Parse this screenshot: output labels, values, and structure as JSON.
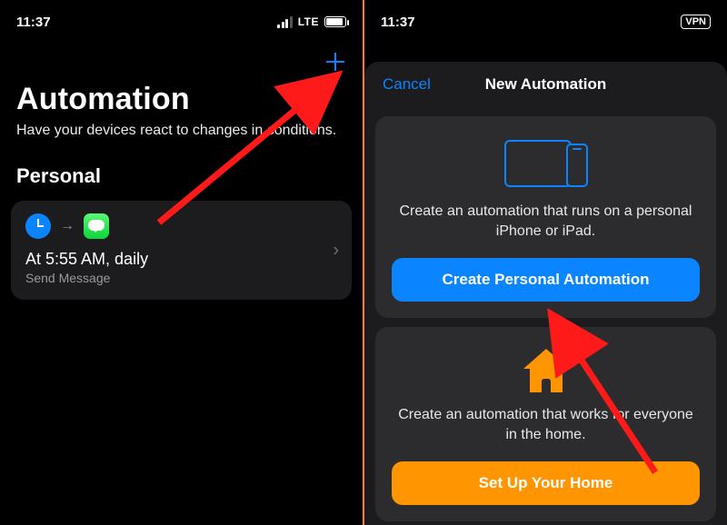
{
  "left": {
    "status": {
      "time": "11:37",
      "network": "LTE"
    },
    "title": "Automation",
    "subtitle": "Have your devices react to changes in conditions.",
    "personal_label": "Personal",
    "automation": {
      "title": "At 5:55 AM, daily",
      "subtitle": "Send Message"
    }
  },
  "right": {
    "status": {
      "time": "11:37",
      "vpn": "VPN"
    },
    "cancel": "Cancel",
    "sheet_title": "New Automation",
    "personal": {
      "desc": "Create an automation that runs on a personal iPhone or iPad.",
      "button": "Create Personal Automation"
    },
    "home": {
      "desc": "Create an automation that works for everyone in the home.",
      "button": "Set Up Your Home"
    }
  },
  "colors": {
    "accent_blue": "#0a84ff",
    "accent_orange": "#ff9500",
    "card_bg": "#1c1c1e",
    "subcard_bg": "#2c2c2e"
  }
}
